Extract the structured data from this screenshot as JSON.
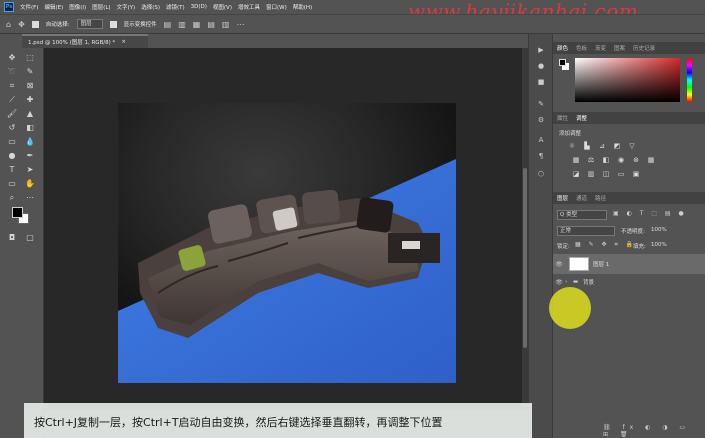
{
  "app": {
    "logo": "Ps"
  },
  "menu": [
    "文件(F)",
    "编辑(E)",
    "图像(I)",
    "图层(L)",
    "文字(Y)",
    "选择(S)",
    "滤镜(T)",
    "3D(D)",
    "视图(V)",
    "增效工具",
    "窗口(W)",
    "帮助(H)"
  ],
  "watermark": "www.hayjikanhai.com",
  "options": {
    "auto_select_label": "自动选择:",
    "auto_select_value": "图层",
    "transform_label": "显示变换控件"
  },
  "document_tab": {
    "title": "1.psd @ 100% (图层 1, RGB/8) *",
    "close": "×"
  },
  "panels": {
    "color_tabs": [
      "颜色",
      "色板",
      "渐变",
      "图案",
      "历史记录"
    ],
    "adjust_tabs": [
      "属性",
      "调整"
    ],
    "adjust_hint": "添加调整",
    "layer_tabs": [
      "图层",
      "通道",
      "路径"
    ],
    "filter_kind": "Q 类型",
    "blend_mode": "正常",
    "opacity_label": "不透明度:",
    "opacity_value": "100%",
    "lock_label": "锁定:",
    "fill_label": "填充:",
    "fill_value": "100%",
    "layers": [
      {
        "name": "图层 1",
        "selected": true
      },
      {
        "name": "背景",
        "selected": false
      }
    ]
  },
  "subtitle": "按Ctrl+J复制一层，按Ctrl+T启动自由变换，然后右键选择垂直翻转，再调整下位置",
  "icons": [
    "move-icon",
    "marquee-icon",
    "lasso-icon",
    "quick-select-icon",
    "crop-icon",
    "frame-icon",
    "eyedropper-icon",
    "healing-icon",
    "brush-icon",
    "stamp-icon",
    "history-brush-icon",
    "eraser-icon",
    "gradient-icon",
    "blur-icon",
    "dodge-icon",
    "pen-icon",
    "type-icon",
    "path-select-icon",
    "rectangle-icon",
    "hand-icon",
    "zoom-icon",
    "more-icon",
    "quickmask-icon",
    "screen-mode-icon"
  ],
  "colors": {
    "accent_blue": "#3a6fd8",
    "cursor_highlight": "#dede1e",
    "watermark": "#e63a3a"
  }
}
